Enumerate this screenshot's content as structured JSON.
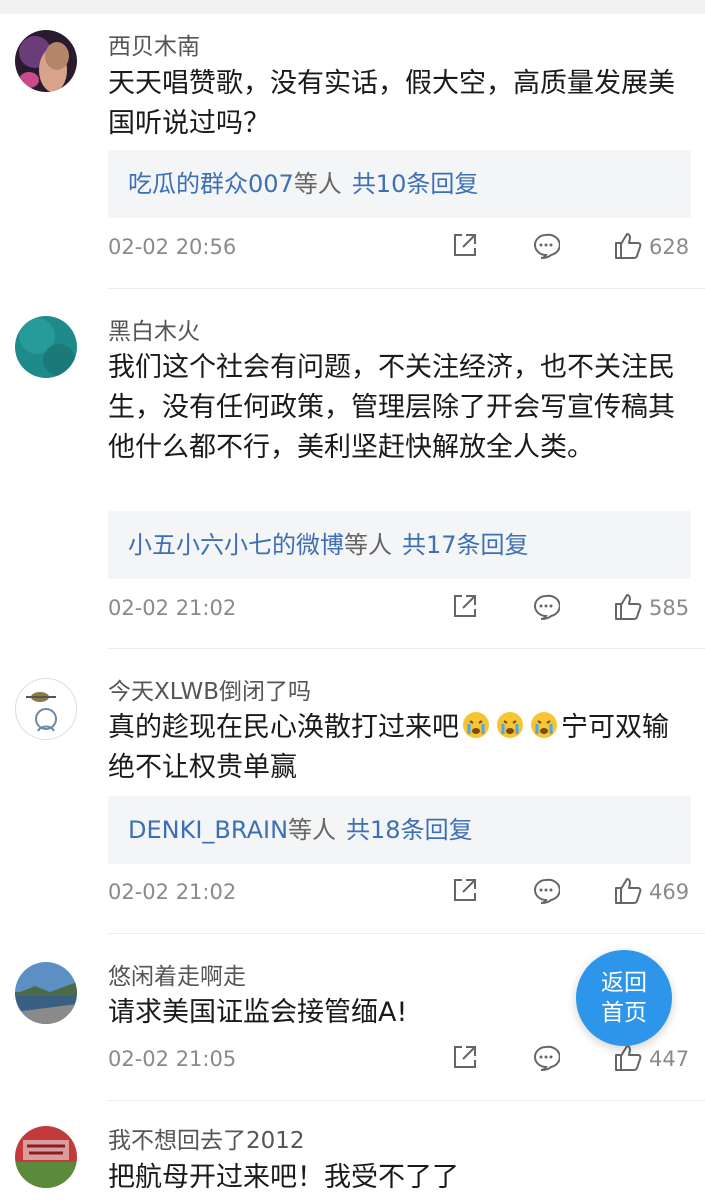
{
  "colors": {
    "accent": "#3d6fb4",
    "home_button": "#2d95ea",
    "meta": "#8a8a8a"
  },
  "comments": [
    {
      "username": "西贝木南",
      "text": "天天唱赞歌，没有实话，假大空，高质量发展美国听说过吗？",
      "reply_names": "吃瓜的群众007",
      "reply_suffix": "等人",
      "reply_count": "共10条回复",
      "time": "02-02 20:56",
      "likes": "628"
    },
    {
      "username": "黑白木火",
      "text": "我们这个社会有问题，不关注经济，也不关注民生，没有任何政策，管理层除了开会写宣传稿其他什么都不行，美利坚赶快解放全人类。",
      "reply_names": "小五小六小七的微博",
      "reply_suffix": "等人",
      "reply_count": "共17条回复",
      "time": "02-02 21:02",
      "likes": "585"
    },
    {
      "username": "今天XLWB倒闭了吗",
      "text_a": "真的趁现在民心涣散打过来吧",
      "text_b": "宁可双输绝不让权贵单赢",
      "emoji_icon": "crying-face-emoji",
      "reply_names": "DENKI_BRAIN",
      "reply_suffix": "等人",
      "reply_count": "共18条回复",
      "time": "02-02 21:02",
      "likes": "469"
    },
    {
      "username": "悠闲着走啊走",
      "text": "请求美国证监会接管缅A!",
      "time": "02-02 21:05",
      "likes": "447"
    },
    {
      "username": "我不想回去了2012",
      "text": "把航母开过来吧！我受不了了"
    }
  ],
  "home_button": {
    "line1": "返回",
    "line2": "首页"
  },
  "icons": {
    "share": "share-icon",
    "comment": "comment-icon",
    "like": "thumbs-up-icon"
  }
}
